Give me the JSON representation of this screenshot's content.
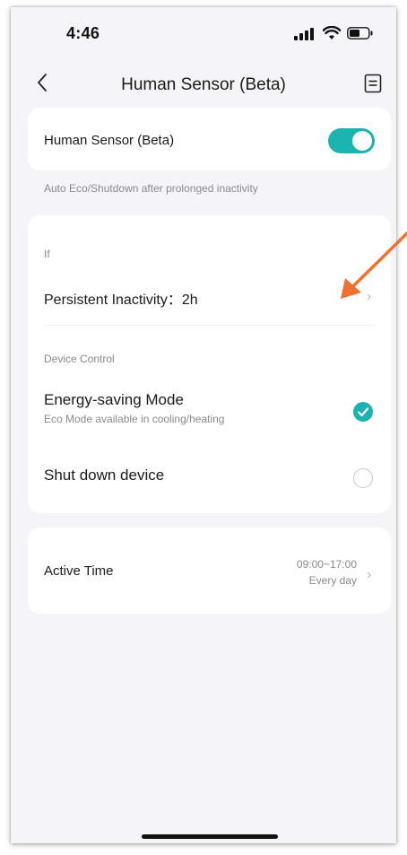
{
  "status_bar": {
    "time": "4:46"
  },
  "nav": {
    "title": "Human Sensor (Beta)"
  },
  "sensor_card": {
    "label": "Human Sensor (Beta)",
    "toggle_on": true
  },
  "hint_text": "Auto Eco/Shutdown after prolonged inactivity",
  "rule_card": {
    "if_label": "If",
    "inactivity_label": "Persistent Inactivity：2h",
    "device_control_label": "Device Control",
    "options": [
      {
        "title": "Energy-saving Mode",
        "subtitle": "Eco Mode available in cooling/heating",
        "selected": true
      },
      {
        "title": "Shut down device",
        "subtitle": "",
        "selected": false
      }
    ]
  },
  "active_time": {
    "label": "Active Time",
    "range": "09:00~17:00",
    "repeat": "Every day"
  },
  "colors": {
    "accent": "#1ab3b0",
    "annotation_arrow": "#f07030"
  }
}
